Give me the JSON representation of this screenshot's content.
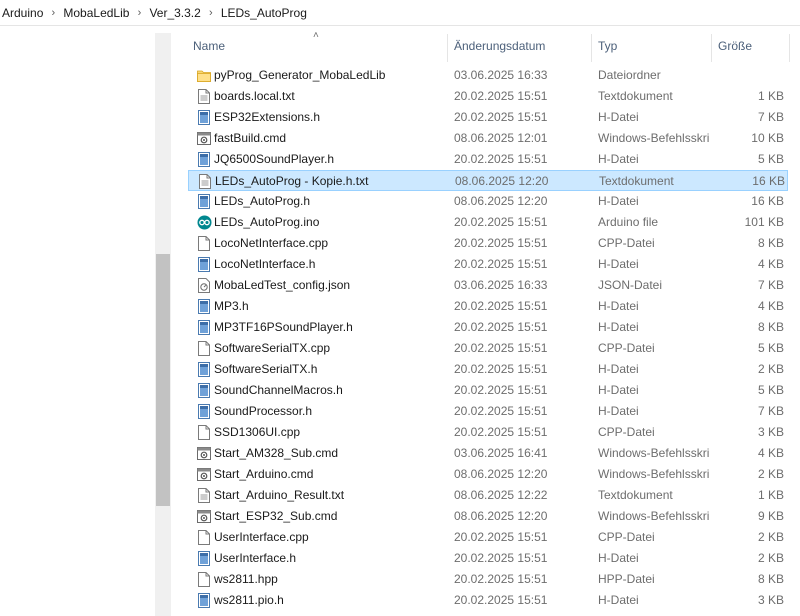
{
  "breadcrumb": [
    "Arduino",
    "MobaLedLib",
    "Ver_3.3.2",
    "LEDs_AutoProg"
  ],
  "columns": {
    "name": "Name",
    "date": "Änderungsdatum",
    "type": "Typ",
    "size": "Größe"
  },
  "accent": "#cce8ff",
  "files": [
    {
      "name": "pyProg_Generator_MobaLedLib",
      "date": "03.06.2025 16:33",
      "type": "Dateiordner",
      "size": "",
      "icon": "folder-icon"
    },
    {
      "name": "boards.local.txt",
      "date": "20.02.2025 15:51",
      "type": "Textdokument",
      "size": "1 KB",
      "icon": "text-file-icon"
    },
    {
      "name": "ESP32Extensions.h",
      "date": "20.02.2025 15:51",
      "type": "H-Datei",
      "size": "7 KB",
      "icon": "h-file-icon"
    },
    {
      "name": "fastBuild.cmd",
      "date": "08.06.2025 12:01",
      "type": "Windows-Befehlsskript",
      "size": "10 KB",
      "icon": "cmd-file-icon"
    },
    {
      "name": "JQ6500SoundPlayer.h",
      "date": "20.02.2025 15:51",
      "type": "H-Datei",
      "size": "5 KB",
      "icon": "h-file-icon"
    },
    {
      "name": "LEDs_AutoProg - Kopie.h.txt",
      "date": "08.06.2025 12:20",
      "type": "Textdokument",
      "size": "16 KB",
      "icon": "text-file-icon",
      "selected": true
    },
    {
      "name": "LEDs_AutoProg.h",
      "date": "08.06.2025 12:20",
      "type": "H-Datei",
      "size": "16 KB",
      "icon": "h-file-icon"
    },
    {
      "name": "LEDs_AutoProg.ino",
      "date": "20.02.2025 15:51",
      "type": "Arduino file",
      "size": "101 KB",
      "icon": "arduino-file-icon"
    },
    {
      "name": "LocoNetInterface.cpp",
      "date": "20.02.2025 15:51",
      "type": "CPP-Datei",
      "size": "8 KB",
      "icon": "cpp-file-icon"
    },
    {
      "name": "LocoNetInterface.h",
      "date": "20.02.2025 15:51",
      "type": "H-Datei",
      "size": "4 KB",
      "icon": "h-file-icon"
    },
    {
      "name": "MobaLedTest_config.json",
      "date": "03.06.2025 16:33",
      "type": "JSON-Datei",
      "size": "7 KB",
      "icon": "json-file-icon"
    },
    {
      "name": "MP3.h",
      "date": "20.02.2025 15:51",
      "type": "H-Datei",
      "size": "4 KB",
      "icon": "h-file-icon"
    },
    {
      "name": "MP3TF16PSoundPlayer.h",
      "date": "20.02.2025 15:51",
      "type": "H-Datei",
      "size": "8 KB",
      "icon": "h-file-icon"
    },
    {
      "name": "SoftwareSerialTX.cpp",
      "date": "20.02.2025 15:51",
      "type": "CPP-Datei",
      "size": "5 KB",
      "icon": "cpp-file-icon"
    },
    {
      "name": "SoftwareSerialTX.h",
      "date": "20.02.2025 15:51",
      "type": "H-Datei",
      "size": "2 KB",
      "icon": "h-file-icon"
    },
    {
      "name": "SoundChannelMacros.h",
      "date": "20.02.2025 15:51",
      "type": "H-Datei",
      "size": "5 KB",
      "icon": "h-file-icon"
    },
    {
      "name": "SoundProcessor.h",
      "date": "20.02.2025 15:51",
      "type": "H-Datei",
      "size": "7 KB",
      "icon": "h-file-icon"
    },
    {
      "name": "SSD1306UI.cpp",
      "date": "20.02.2025 15:51",
      "type": "CPP-Datei",
      "size": "3 KB",
      "icon": "cpp-file-icon"
    },
    {
      "name": "Start_AM328_Sub.cmd",
      "date": "03.06.2025 16:41",
      "type": "Windows-Befehlsskript",
      "size": "4 KB",
      "icon": "cmd-file-icon"
    },
    {
      "name": "Start_Arduino.cmd",
      "date": "08.06.2025 12:20",
      "type": "Windows-Befehlsskript",
      "size": "2 KB",
      "icon": "cmd-file-icon"
    },
    {
      "name": "Start_Arduino_Result.txt",
      "date": "08.06.2025 12:22",
      "type": "Textdokument",
      "size": "1 KB",
      "icon": "text-file-icon"
    },
    {
      "name": "Start_ESP32_Sub.cmd",
      "date": "08.06.2025 12:20",
      "type": "Windows-Befehlsskript",
      "size": "9 KB",
      "icon": "cmd-file-icon"
    },
    {
      "name": "UserInterface.cpp",
      "date": "20.02.2025 15:51",
      "type": "CPP-Datei",
      "size": "2 KB",
      "icon": "cpp-file-icon"
    },
    {
      "name": "UserInterface.h",
      "date": "20.02.2025 15:51",
      "type": "H-Datei",
      "size": "2 KB",
      "icon": "h-file-icon"
    },
    {
      "name": "ws2811.hpp",
      "date": "20.02.2025 15:51",
      "type": "HPP-Datei",
      "size": "8 KB",
      "icon": "hpp-file-icon"
    },
    {
      "name": "ws2811.pio.h",
      "date": "20.02.2025 15:51",
      "type": "H-Datei",
      "size": "3 KB",
      "icon": "h-file-icon"
    }
  ]
}
